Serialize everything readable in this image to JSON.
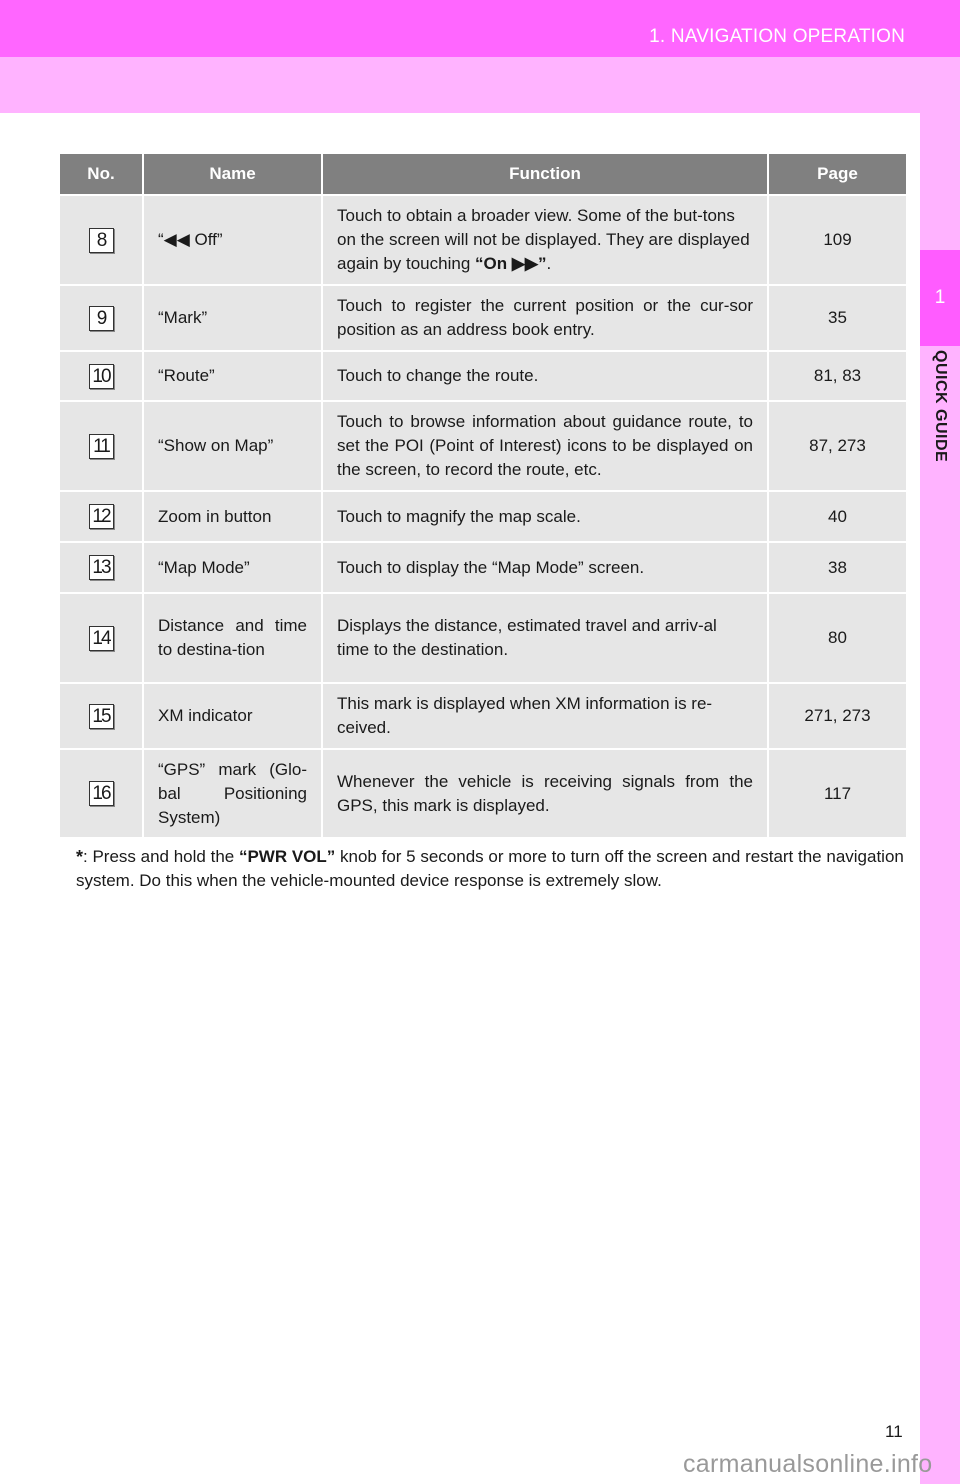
{
  "header": {
    "section_title": "1. NAVIGATION OPERATION"
  },
  "side_tab": {
    "number": "1",
    "label": "QUICK GUIDE"
  },
  "colors": {
    "header_magenta": "#ff66ff",
    "sub_band_pink": "#ffb3ff",
    "tab_magenta": "#ff5cff",
    "table_header_gray": "#808080",
    "table_cell_gray": "#e6e6e6"
  },
  "table": {
    "headers": [
      "No.",
      "Name",
      "Function",
      "Page"
    ],
    "rows": [
      {
        "no": "8",
        "name": "“◀◀ Off”",
        "function_pre": "Touch to obtain a broader view. Some of the but-tons on the screen will not be displayed. They are displayed again by touching ",
        "function_bold": "“On ▶▶”",
        "function_post": ".",
        "page": "109"
      },
      {
        "no": "9",
        "name": "“Mark”",
        "function": "Touch to register the current position or the cur-sor position as an address book entry.",
        "page": "35"
      },
      {
        "no": "10",
        "name": "“Route”",
        "function": "Touch to change the route.",
        "page": "81, 83"
      },
      {
        "no": "11",
        "name": "“Show on Map”",
        "function": "Touch to browse information about guidance route, to set the POI (Point of Interest) icons to be displayed on the screen, to record the route, etc.",
        "page": "87, 273"
      },
      {
        "no": "12",
        "name": "Zoom in button",
        "function": "Touch to magnify the map scale.",
        "page": "40"
      },
      {
        "no": "13",
        "name": "“Map Mode”",
        "function": "Touch to display the “Map Mode” screen.",
        "page": "38"
      },
      {
        "no": "14",
        "name": "Distance and time to destina-tion",
        "function": "Displays the distance, estimated travel and arriv-al time to the destination.",
        "page": "80"
      },
      {
        "no": "15",
        "name": "XM indicator",
        "function": "This mark is displayed when XM information is re-ceived.",
        "page": "271, 273"
      },
      {
        "no": "16",
        "name": "“GPS” mark (Glo-bal Positioning System)",
        "function": "Whenever the vehicle is receiving signals from the GPS, this mark is displayed.",
        "page": "117"
      }
    ]
  },
  "footnote": {
    "marker": "*",
    "text_pre": ": Press and hold the ",
    "text_bold": "“PWR VOL”",
    "text_post": " knob for 5 seconds or more to turn off the screen and restart the navigation system. Do this when the vehicle-mounted device response is extremely slow."
  },
  "page_number": "11",
  "watermark": "carmanualsonline.info"
}
